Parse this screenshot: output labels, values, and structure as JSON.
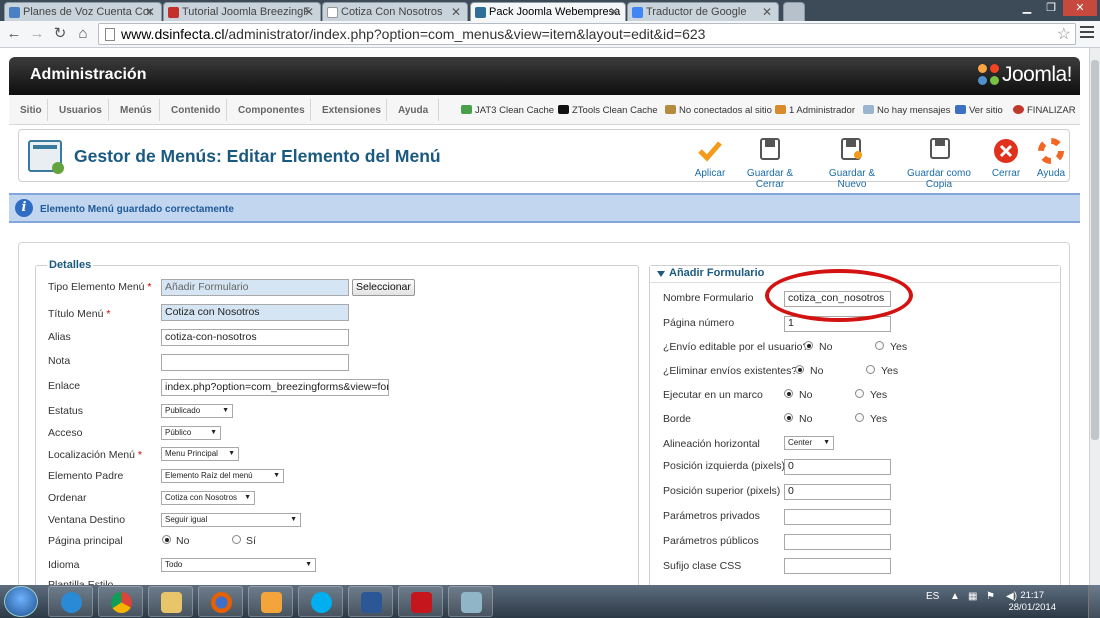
{
  "browser": {
    "tabs": [
      {
        "title": "Planes de Voz Cuenta Cor",
        "active": false
      },
      {
        "title": "Tutorial Joomla BreezingF",
        "active": false
      },
      {
        "title": "Cotiza Con Nosotros",
        "active": false
      },
      {
        "title": "Pack Joomla Webempresa",
        "active": true
      },
      {
        "title": "Traductor de Google",
        "active": false
      }
    ],
    "url_host": "www.dsinfecta.cl",
    "url_path": "/administrator/index.php?option=com_menus&view=item&layout=edit&id=623"
  },
  "admin": {
    "title": "Administración",
    "logo_text": "Joomla!",
    "menu": [
      "Sitio",
      "Usuarios",
      "Menús",
      "Contenido",
      "Componentes",
      "Extensiones",
      "Ayuda"
    ],
    "status": {
      "jat3": "JAT3 Clean Cache",
      "ztools": "ZTools Clean Cache",
      "connected": "No conectados al sitio",
      "admins": "1 Administrador",
      "messages": "No hay mensajes",
      "view_site": "Ver sitio",
      "logout": "FINALIZAR"
    }
  },
  "toolbar": {
    "page_title": "Gestor de Menús: Editar Elemento del Menú",
    "buttons": [
      "Aplicar",
      "Guardar & Cerrar",
      "Guardar & Nuevo",
      "Guardar como Copia",
      "Cerrar",
      "Ayuda"
    ]
  },
  "message": "Elemento Menú guardado correctamente",
  "details": {
    "legend": "Detalles",
    "tipo_label": "Tipo Elemento Menú",
    "tipo_value": "Añadir Formulario",
    "select_button": "Seleccionar",
    "titulo_label": "Título Menú",
    "titulo_value": "Cotiza con Nosotros",
    "alias_label": "Alias",
    "alias_value": "cotiza-con-nosotros",
    "nota_label": "Nota",
    "nota_value": "",
    "enlace_label": "Enlace",
    "enlace_value": "index.php?option=com_breezingforms&view=form",
    "estatus_label": "Estatus",
    "estatus_value": "Publicado",
    "acceso_label": "Acceso",
    "acceso_value": "Público",
    "localizacion_label": "Localización Menú",
    "localizacion_value": "Menu Principal",
    "padre_label": "Elemento Padre",
    "padre_value": "Elemento Raíz del menú",
    "ordenar_label": "Ordenar",
    "ordenar_value": "Cotiza con Nosotros",
    "ventana_label": "Ventana Destino",
    "ventana_value": "Seguir igual",
    "principal_label": "Página principal",
    "principal_no": "No",
    "principal_si": "Sí",
    "idioma_label": "Idioma",
    "idioma_value": "Todo",
    "plantilla_label": "Plantilla Estilo"
  },
  "form_panel": {
    "title": "Añadir Formulario",
    "nombre_label": "Nombre Formulario",
    "nombre_value": "cotiza_con_nosotros",
    "pagina_label": "Página número",
    "pagina_value": "1",
    "envio_editable_label": "¿Envío editable por el usuario?",
    "eliminar_label": "¿Eliminar envíos existentes?",
    "marco_label": "Ejecutar en un marco",
    "borde_label": "Borde",
    "no": "No",
    "yes": "Yes",
    "alineacion_label": "Alineación horizontal",
    "alineacion_value": "Center",
    "pos_izq_label": "Posición izquierda (pixels)",
    "pos_izq_value": "0",
    "pos_sup_label": "Posición superior (pixels)",
    "pos_sup_value": "0",
    "privados_label": "Parámetros privados",
    "publicos_label": "Parámetros públicos",
    "sufijo_label": "Sufijo clase CSS"
  },
  "taskbar": {
    "lang": "ES",
    "time": "21:17",
    "date": "28/01/2014"
  },
  "colors": {
    "joomla_blue": "#1a5a80",
    "annotation_red": "#d31212",
    "message_bg": "#c3d6ef"
  }
}
